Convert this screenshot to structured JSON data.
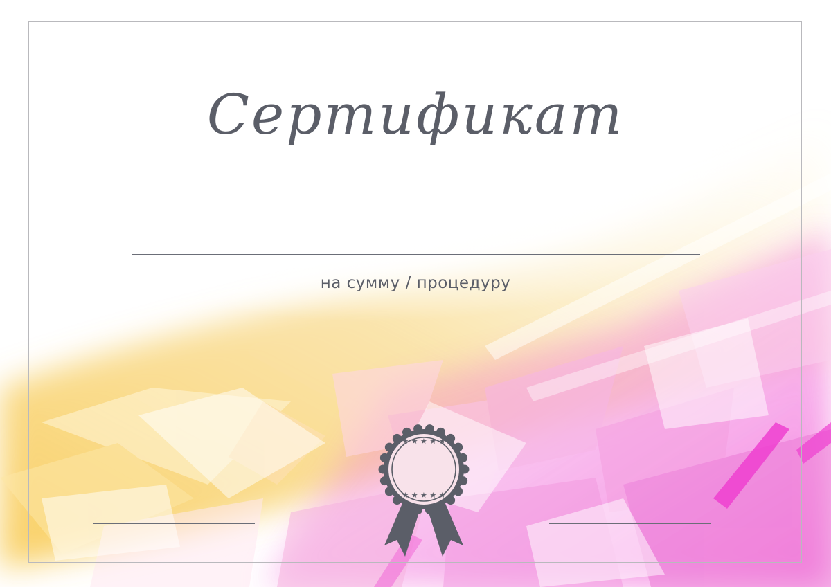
{
  "certificate": {
    "title": "Сертификат",
    "subtitle": "на сумму / процедуру"
  },
  "colors": {
    "frame": "#b9b9bd",
    "text": "#5b5e68",
    "badge": "#5b5e68",
    "accent_yellow": "#f8c84a",
    "accent_pink": "#ee3fd0"
  },
  "icons": {
    "badge": "award-ribbon-icon",
    "stars": "star-icon"
  }
}
